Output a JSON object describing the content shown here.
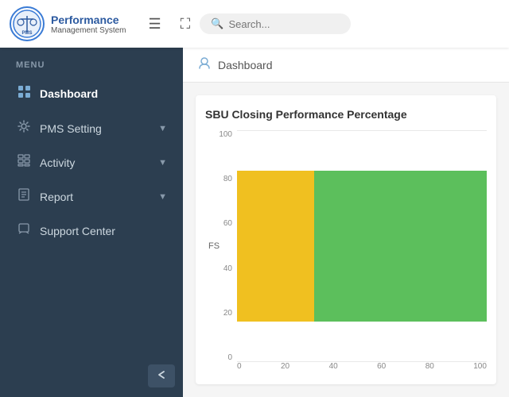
{
  "header": {
    "logo_title": "Performance",
    "logo_subtitle": "Management System",
    "logo_inner_text": "PMS",
    "search_placeholder": "Search..."
  },
  "sidebar": {
    "menu_label": "MENU",
    "items": [
      {
        "id": "dashboard",
        "label": "Dashboard",
        "icon": "⊞",
        "active": true,
        "has_chevron": false
      },
      {
        "id": "pms-setting",
        "label": "PMS Setting",
        "icon": "⚙",
        "active": false,
        "has_chevron": true
      },
      {
        "id": "activity",
        "label": "Activity",
        "icon": "▦",
        "active": false,
        "has_chevron": true
      },
      {
        "id": "report",
        "label": "Report",
        "icon": "▤",
        "active": false,
        "has_chevron": true
      },
      {
        "id": "support",
        "label": "Support Center",
        "icon": "□",
        "active": false,
        "has_chevron": false
      }
    ],
    "collapse_icon": "⇐"
  },
  "breadcrumb": {
    "icon": "☺",
    "text": "Dashboard"
  },
  "chart": {
    "title": "SBU Closing Performance Percentage",
    "y_labels": [
      "100",
      "80",
      "60",
      "40",
      "20",
      "0"
    ],
    "x_labels": [
      "0",
      "20",
      "40",
      "60",
      "80",
      "100"
    ],
    "row_label": "FS",
    "bar_yellow_pct": 31,
    "bar_green_pct": 69,
    "colors": {
      "yellow": "#f0c020",
      "green": "#5cbf5c"
    }
  }
}
